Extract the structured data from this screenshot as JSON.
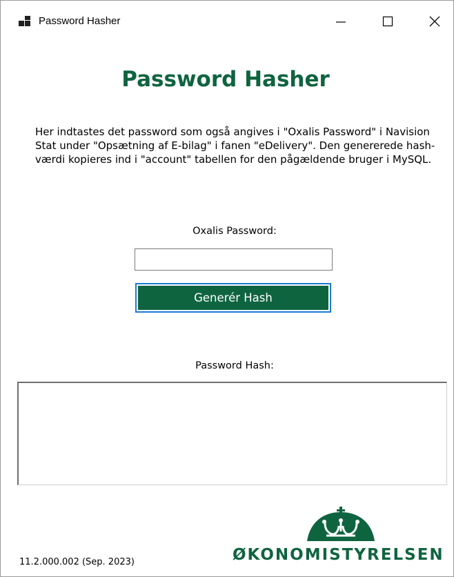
{
  "window": {
    "title": "Password Hasher",
    "icon": "app-window-icon",
    "controls": {
      "minimize": "minimize-icon",
      "maximize": "maximize-icon",
      "close": "close-icon"
    }
  },
  "main": {
    "heading": "Password Hasher",
    "description": "Her indtastes det password som også angives i \"Oxalis Password\" i Navision Stat under \"Opsætning af E-bilag\" i fanen \"eDelivery\". Den genererede hash-værdi kopieres ind i \"account\" tabellen for den pågældende bruger i MySQL.",
    "password_label": "Oxalis Password:",
    "password_value": "",
    "generate_button": "Generér Hash",
    "hash_label": "Password Hash:",
    "hash_value": ""
  },
  "footer": {
    "version": "11.2.000.002 (Sep. 2023)",
    "logo_text": "ØKONOMISTYRELSEN",
    "logo_icon": "crown-icon"
  },
  "colors": {
    "brand_green": "#0f6440",
    "focus_blue": "#1a7ad4"
  }
}
